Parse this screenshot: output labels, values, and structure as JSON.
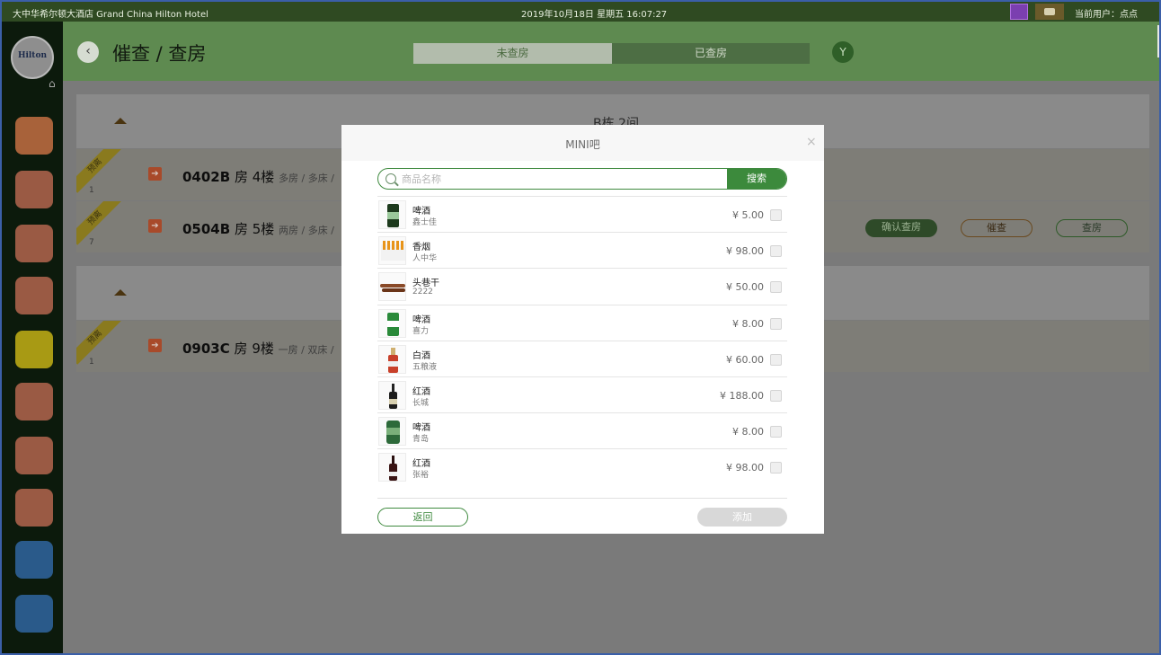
{
  "topbar": {
    "hotel": "大中华希尔顿大酒店  Grand China Hilton Hotel",
    "datetime": "2019年10月18日 星期五 16:07:27",
    "user": "当前用户：点点"
  },
  "sidebar": {
    "logo": "Hilton",
    "items": [
      {
        "name": "search-icon",
        "color": "#a8623a"
      },
      {
        "name": "check-envelope-icon",
        "color": "#9a5a44"
      },
      {
        "name": "lock-house-icon",
        "color": "#9a5a44"
      },
      {
        "name": "card-reader-icon",
        "color": "#9a5a44"
      },
      {
        "name": "refresh-clock-icon",
        "color": "#a89a14"
      },
      {
        "name": "checklist-icon",
        "color": "#9a5a44"
      },
      {
        "name": "room-grid-icon",
        "color": "#9a5a44"
      },
      {
        "name": "sliders-icon",
        "color": "#9a5a44"
      },
      {
        "name": "staff-icon",
        "color": "#2a5a8a"
      },
      {
        "name": "edit-icon",
        "color": "#2a5a8a"
      }
    ]
  },
  "header": {
    "title": "催查 / 查房",
    "tab_unchecked": "未查房",
    "tab_checked": "已查房"
  },
  "building": {
    "name": "B栋 2间",
    "rooms": [
      {
        "badge": "预离",
        "num": "1",
        "room": "0402B",
        "suffix": "房 4楼",
        "desc": "多房 / 多床 /"
      },
      {
        "badge": "预离",
        "num": "7",
        "room": "0504B",
        "suffix": "房 5楼",
        "desc": "两房 / 多床 /",
        "actions": [
          "确认查房",
          "催查",
          "查房"
        ]
      }
    ]
  },
  "building2": {
    "rooms": [
      {
        "badge": "预离",
        "num": "1",
        "room": "0903C",
        "suffix": "房 9楼",
        "desc": "一房 / 双床 /"
      }
    ]
  },
  "modal": {
    "title": "MINI吧",
    "search_placeholder": "商品名称",
    "search_button": "搜索",
    "items": [
      {
        "name": "啤酒",
        "brand": "鑫士佳",
        "price": "¥ 5.00",
        "thumb": "beer-can-black"
      },
      {
        "name": "香烟",
        "brand": "人中华",
        "price": "¥ 98.00",
        "thumb": "cigarettes"
      },
      {
        "name": "头巷干",
        "brand": "2222",
        "price": "¥ 50.00",
        "thumb": "dried-meat"
      },
      {
        "name": "啤酒",
        "brand": "喜力",
        "price": "¥ 8.00",
        "thumb": "beer-can-green"
      },
      {
        "name": "白酒",
        "brand": "五粮液",
        "price": "¥ 60.00",
        "thumb": "liquor-bottle"
      },
      {
        "name": "红酒",
        "brand": "长城",
        "price": "¥ 188.00",
        "thumb": "wine-bottle"
      },
      {
        "name": "啤酒",
        "brand": "青岛",
        "price": "¥ 8.00",
        "thumb": "beer-can-green2"
      },
      {
        "name": "红酒",
        "brand": "张裕",
        "price": "¥ 98.00",
        "thumb": "wine-bottle2"
      }
    ],
    "return_button": "返回",
    "add_button": "添加"
  }
}
